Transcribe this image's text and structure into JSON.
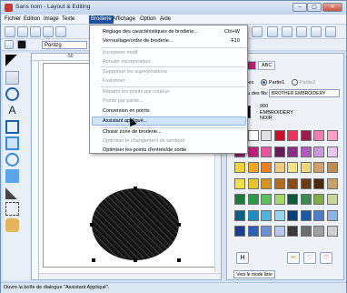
{
  "window": {
    "title": "Sans nom - Layout & Editing",
    "controls": [
      "‒",
      "▢",
      "✕"
    ]
  },
  "menu": [
    "Fichier",
    "Edition",
    "Image",
    "Texte",
    "Broderie",
    "Affichage",
    "Option",
    "Aide"
  ],
  "toolbar2": {
    "font_name": "Pontzg"
  },
  "ruler": {
    "label": "50"
  },
  "dropdown": {
    "items": [
      {
        "label": "Réglage des caractéristiques de broderie...",
        "shortcut": "Ctrl+W",
        "disabled": false
      },
      {
        "label": "Verrouillage/ordre de broderie...",
        "shortcut": "F10",
        "disabled": false
      },
      {
        "label": "Incorporer motif",
        "shortcut": "",
        "disabled": true
      },
      {
        "label": "Annuler incorporation",
        "shortcut": "",
        "disabled": true
      },
      {
        "label": "Supprimer les superpositions",
        "shortcut": "",
        "disabled": true
      },
      {
        "label": "Fusionner",
        "shortcut": "",
        "disabled": true
      },
      {
        "label": "Répartir les points par couleur",
        "shortcut": "",
        "disabled": true
      },
      {
        "label": "Points par partie...",
        "shortcut": "",
        "disabled": true
      },
      {
        "label": "Conversion en points",
        "shortcut": "",
        "disabled": false
      },
      {
        "label": "Assistant appliqué...",
        "shortcut": "",
        "disabled": false
      },
      {
        "label": "Choisir zone de broderie...",
        "shortcut": "",
        "disabled": false
      },
      {
        "label": "Optimiser le changement de tambour",
        "shortcut": "",
        "disabled": true
      },
      {
        "label": "Optimiser les points d'entrée/de sortie",
        "shortcut": "",
        "disabled": false
      }
    ]
  },
  "panel": {
    "tabs": [
      "|",
      "ABC"
    ],
    "radios": [
      "lignes",
      "Partie1",
      "Partie2"
    ],
    "table_label": "Tableau des fils:",
    "table_value": "BROTHER EMBROIDERY",
    "thread_info": [
      "900",
      "EMBROIDERY",
      "NOIR"
    ],
    "thread_color": "#000000",
    "palette": [
      "#000000",
      "#ffffff",
      "#e0e0e0",
      "#c8102e",
      "#e8355a",
      "#9b1b4b",
      "#f07db0",
      "#ff9fc4",
      "#9c1f6e",
      "#c02078",
      "#e7569a",
      "#6b1a5e",
      "#8e2c8a",
      "#b05ac0",
      "#ce98df",
      "#e8c6ee",
      "#f3d23a",
      "#f6a623",
      "#f07f1d",
      "#f5c97b",
      "#f2e288",
      "#efd67c",
      "#d3a16e",
      "#bf8b54",
      "#f0e14c",
      "#e8c430",
      "#d69320",
      "#b36d20",
      "#8a4c1c",
      "#6b3b18",
      "#4b2810",
      "#c9a36b",
      "#1f7a3b",
      "#2b9b49",
      "#5cbf5e",
      "#a3d86a",
      "#0c5c3a",
      "#3c8a4d",
      "#7fae48",
      "#c6d89a",
      "#0d5e87",
      "#1c8ec6",
      "#52b3dc",
      "#98d4ef",
      "#0a3d7a",
      "#1b58a6",
      "#4c7fc9",
      "#8cb2e3",
      "#1a3f8f",
      "#2f5fb8",
      "#6e8fd6",
      "#b9c8ec",
      "#3a3a3a",
      "#6c6c6c",
      "#a0a0a0",
      "#d0d0d0"
    ],
    "bottom_buttons": [
      "H",
      "✂",
      "♡",
      "♡"
    ],
    "mode_button": "Vers le mode liste"
  },
  "statusbar": {
    "text": "Ouvre la boîte de dialogue \"Assistant Appliqué\"."
  }
}
